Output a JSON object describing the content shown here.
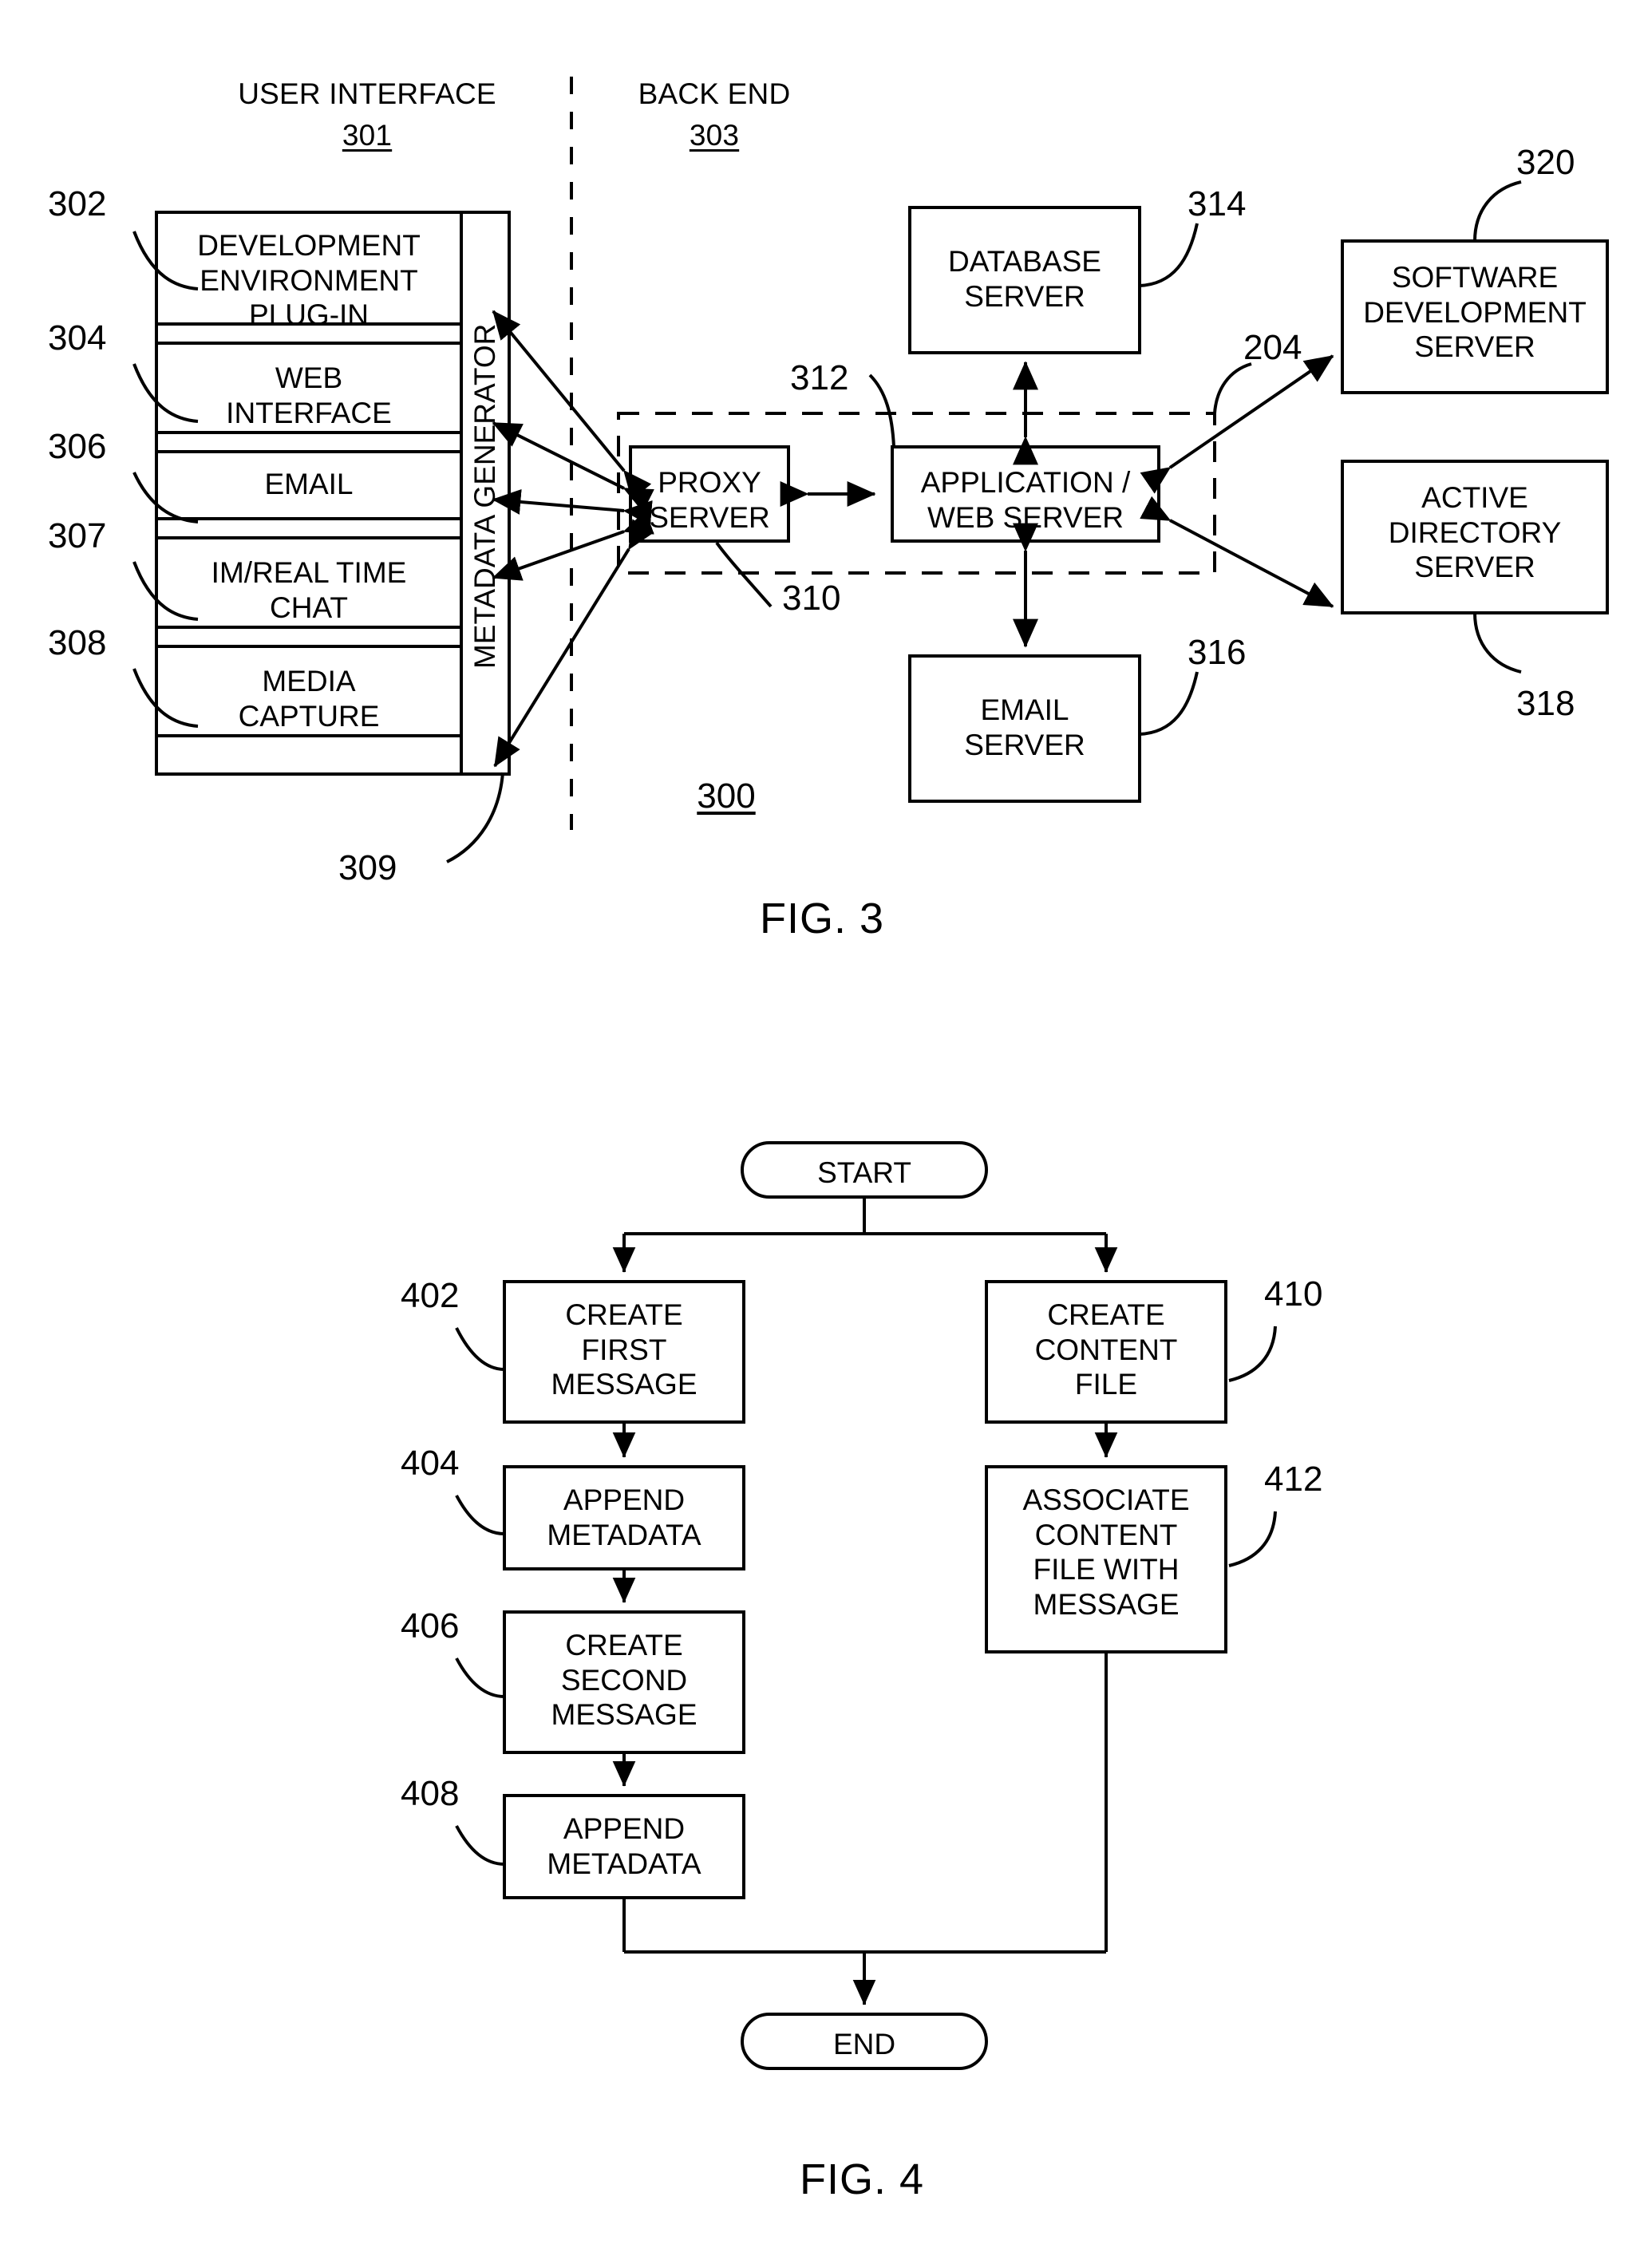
{
  "figure3": {
    "title": "FIG. 3",
    "system_ref": "300",
    "columns": {
      "left": {
        "label": "USER INTERFACE",
        "ref": "301"
      },
      "right": {
        "label": "BACK END",
        "ref": "303"
      }
    },
    "ui_modules": [
      {
        "label": "DEVELOPMENT\nENVIRONMENT\nPLUG-IN",
        "ref": "302"
      },
      {
        "label": "WEB\nINTERFACE",
        "ref": "304"
      },
      {
        "label": "EMAIL",
        "ref": "306"
      },
      {
        "label": "IM/REAL TIME\nCHAT",
        "ref": "307"
      },
      {
        "label": "MEDIA\nCAPTURE",
        "ref": "308"
      }
    ],
    "metadata_generator": {
      "label": "METADATA GENERATOR",
      "ref": "309"
    },
    "backend_nodes": [
      {
        "label": "PROXY\nSERVER",
        "ref": "310"
      },
      {
        "label": "APPLICATION /\nWEB SERVER",
        "ref": "312"
      },
      {
        "label": "DATABASE\nSERVER",
        "ref": "314"
      },
      {
        "label": "EMAIL\nSERVER",
        "ref": "316"
      },
      {
        "label": "SOFTWARE\nDEVELOPMENT\nSERVER",
        "ref": "320"
      },
      {
        "label": "ACTIVE\nDIRECTORY\nSERVER",
        "ref": "318"
      }
    ],
    "dashed_group_ref": "204"
  },
  "figure4": {
    "title": "FIG. 4",
    "start_label": "START",
    "end_label": "END",
    "left_branch": [
      {
        "label": "CREATE\nFIRST\nMESSAGE",
        "ref": "402"
      },
      {
        "label": "APPEND\nMETADATA",
        "ref": "404"
      },
      {
        "label": "CREATE\nSECOND\nMESSAGE",
        "ref": "406"
      },
      {
        "label": "APPEND\nMETADATA",
        "ref": "408"
      }
    ],
    "right_branch": [
      {
        "label": "CREATE\nCONTENT\nFILE",
        "ref": "410"
      },
      {
        "label": "ASSOCIATE\nCONTENT\nFILE WITH\nMESSAGE",
        "ref": "412"
      }
    ]
  },
  "colors": {
    "ink": "#000000",
    "paper": "#ffffff"
  }
}
